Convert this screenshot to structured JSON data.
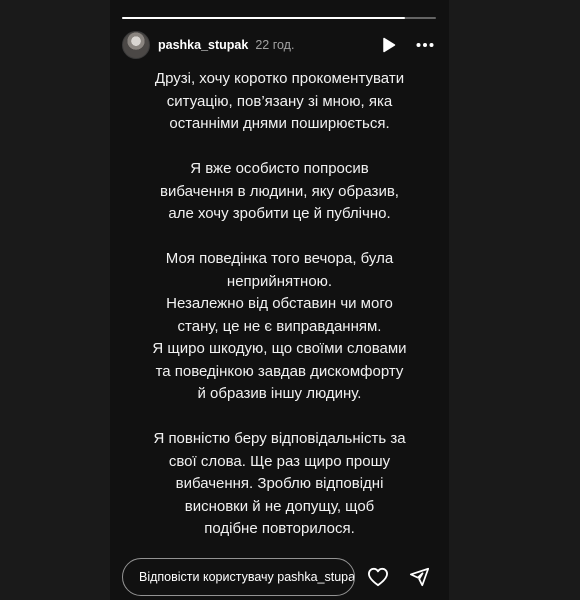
{
  "story": {
    "progress": 0.9,
    "author": {
      "username": "pashka_stupak",
      "time": "22 год."
    },
    "paragraphs": [
      [
        "Друзі, хочу коротко прокоментувати",
        "ситуацію, пов’язану зі мною, яка",
        "останніми днями поширюється."
      ],
      [
        "Я вже особисто попросив",
        "вибачення в людини, яку образив,",
        "але хочу зробити це й публічно."
      ],
      [
        "Моя поведінка того вечора, була",
        "неприйнятною.",
        "Незалежно від обставин чи мого",
        "стану, це не є виправданням.",
        "Я щиро шкодую, що своїми словами",
        "та поведінкою завдав дискомфорту",
        "й образив іншу людину."
      ],
      [
        "Я повністю беру відповідальність за",
        "свої слова. Ще раз щиро прошу",
        "вибачення. Зроблю відповідні",
        "висновки й не допущу, щоб",
        "подібне повторилося."
      ]
    ],
    "reply_placeholder": "Відповісти користувачу pashka_stupak..."
  },
  "icons": {
    "play": "play-icon",
    "more": "more-icon",
    "like": "heart-icon",
    "share": "send-icon"
  }
}
